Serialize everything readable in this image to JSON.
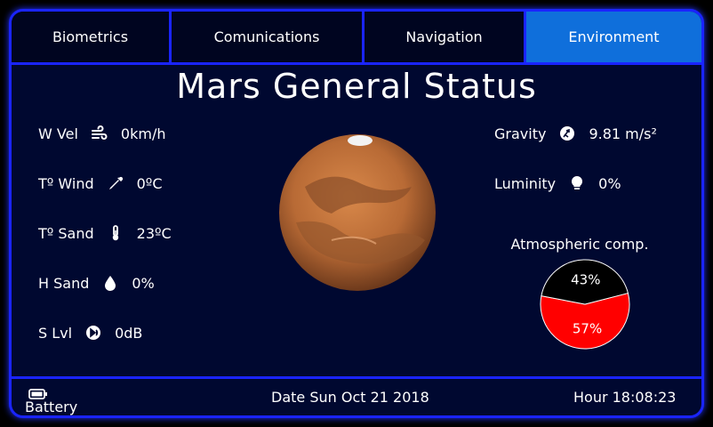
{
  "tabs": [
    {
      "label": "Biometrics"
    },
    {
      "label": "Comunications"
    },
    {
      "label": "Navigation"
    },
    {
      "label": "Environment",
      "active": true
    }
  ],
  "title": "Mars General Status",
  "left_readings": [
    {
      "label": "W Vel",
      "icon": "wind-icon",
      "value": "0km/h"
    },
    {
      "label": "Tº Wind",
      "icon": "pipette-icon",
      "value": "0ºC"
    },
    {
      "label": "Tº Sand",
      "icon": "thermometer-icon",
      "value": "23ºC"
    },
    {
      "label": "H Sand",
      "icon": "water-drop-icon",
      "value": "0%"
    },
    {
      "label": "S Lvl",
      "icon": "sound-level-icon",
      "value": "0dB"
    }
  ],
  "right_readings": [
    {
      "label": "Gravity",
      "icon": "gravity-icon",
      "value": "9.81 m/s²"
    },
    {
      "label": "Luminity",
      "icon": "lightbulb-icon",
      "value": "0%"
    }
  ],
  "atmosphere": {
    "title": "Atmospheric comp.",
    "slices": [
      {
        "label": "57%",
        "value": 57,
        "color": "#ff0000"
      },
      {
        "label": "43%",
        "value": 43,
        "color": "#000000"
      }
    ]
  },
  "footer": {
    "battery_label": "Battery",
    "date_label": "Date Sun Oct 21 2018",
    "hour_label": "Hour 18:08:23"
  },
  "colors": {
    "accent": "#1a24ff",
    "active_tab": "#0f6fdb",
    "background": "#000830"
  }
}
